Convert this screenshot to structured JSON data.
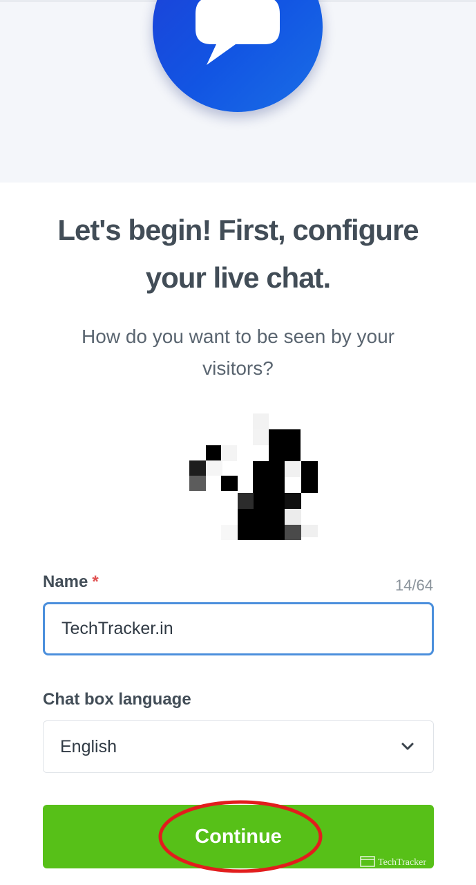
{
  "header": {
    "logo_icon": "chat-bubble-icon",
    "accent_color": "#1a52e0"
  },
  "main": {
    "title_line1": "Let's begin! First, configure",
    "title_line2": "your live chat.",
    "subtitle": "How do you want to be seen by your visitors?",
    "avatar_icon": "pixelated-avatar-image"
  },
  "form": {
    "name_label": "Name",
    "required_mark": "*",
    "char_count": "14/64",
    "name_value": "TechTracker.in",
    "language_label": "Chat box language",
    "language_value": "English",
    "language_icon": "chevron-down-icon"
  },
  "actions": {
    "continue_label": "Continue",
    "continue_color": "#57c018"
  },
  "watermark": {
    "text": "TechTracker"
  }
}
